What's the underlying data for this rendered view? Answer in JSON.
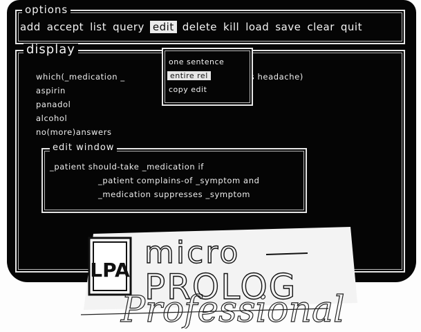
{
  "options": {
    "title": "options",
    "menu": [
      "add",
      "accept",
      "list",
      "query",
      "edit",
      "delete",
      "kill",
      "load",
      "save",
      "clear",
      "quit"
    ],
    "selected": "edit"
  },
  "display": {
    "title": "display",
    "query_left": "which(_medication _",
    "query_right": "es headache)",
    "results": [
      "aspirin",
      "panadol",
      "alcohol",
      "no(more)answers"
    ]
  },
  "popup": {
    "items": [
      "one sentence",
      "entire rel",
      "copy edit"
    ],
    "highlighted": "entire rel"
  },
  "edit_window": {
    "title": "edit window",
    "lines": [
      "_patient should-take _medication if",
      "_patient complains-of _symptom and",
      "_medication suppresses _symptom"
    ]
  },
  "logo": {
    "badge": "LPA",
    "line1": "micro",
    "line2": "PROLOG",
    "line3": "Professional"
  }
}
